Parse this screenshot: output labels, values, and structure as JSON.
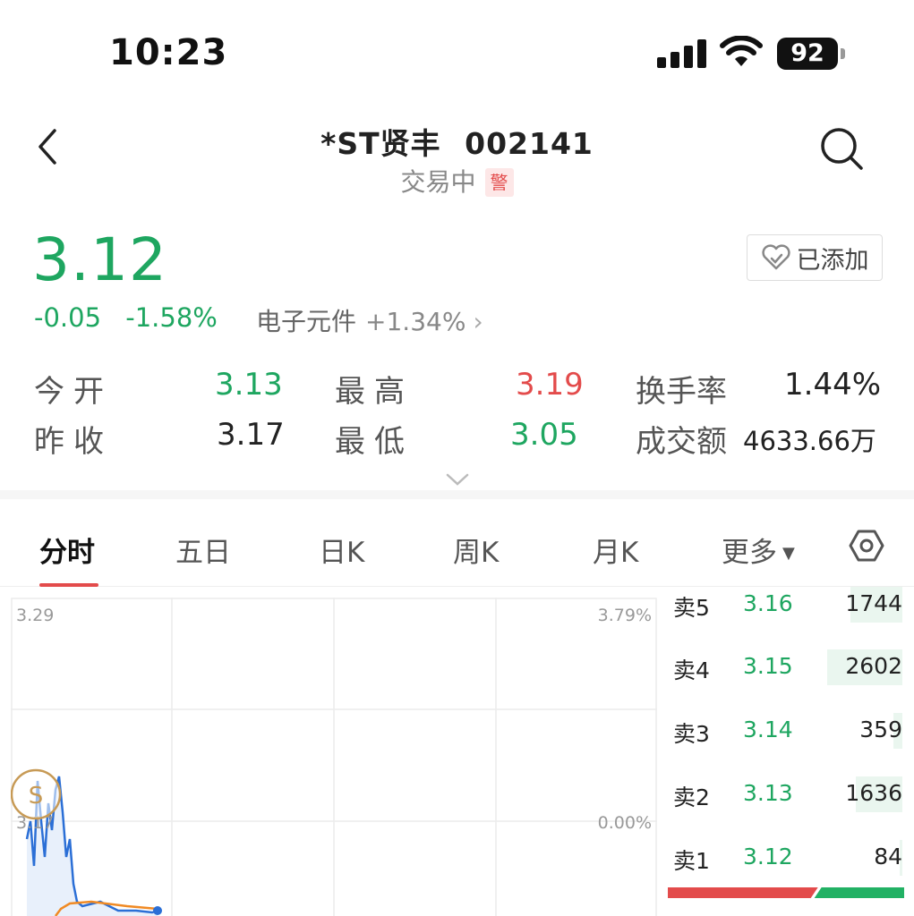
{
  "status_bar": {
    "time": "10:23",
    "battery": "92"
  },
  "header": {
    "stock_name": "*ST贤丰",
    "stock_code": "002141",
    "trading_status": "交易中",
    "warning_badge": "警"
  },
  "quote": {
    "price": "3.12",
    "change": "-0.05",
    "change_pct": "-1.58%",
    "sector_name": "电子元件",
    "sector_pct": "+1.34%",
    "watchlist_label": "已添加"
  },
  "stats": [
    {
      "label": "今开",
      "value": "3.13",
      "color": "green"
    },
    {
      "label": "最高",
      "value": "3.19",
      "color": "red"
    },
    {
      "label": "换手率",
      "value": "1.44%",
      "color": "dark"
    },
    {
      "label": "昨收",
      "value": "3.17",
      "color": "dark"
    },
    {
      "label": "最低",
      "value": "3.05",
      "color": "green"
    },
    {
      "label": "成交额",
      "value": "4633.66万",
      "color": "dark"
    }
  ],
  "tabs": [
    "分时",
    "五日",
    "日K",
    "周K",
    "月K",
    "更多"
  ],
  "active_tab": "分时",
  "chart": {
    "price_top": "3.29",
    "pct_top": "3.79%",
    "price_mid": "3.17",
    "pct_mid": "0.00%",
    "marker": "S",
    "colors": {
      "price_line": "#2b6fd6",
      "avg_line": "#f08a24",
      "grid": "#ececec"
    }
  },
  "order_book": {
    "asks": [
      {
        "label": "卖5",
        "price": "3.16",
        "volume": "1744",
        "depth": 0.22
      },
      {
        "label": "卖4",
        "price": "3.15",
        "volume": "2602",
        "depth": 0.32
      },
      {
        "label": "卖3",
        "price": "3.14",
        "volume": "359",
        "depth": 0.04
      },
      {
        "label": "卖2",
        "price": "3.13",
        "volume": "1636",
        "depth": 0.2
      },
      {
        "label": "卖1",
        "price": "3.12",
        "volume": "84",
        "depth": 0.01
      }
    ],
    "buy_ratio": 0.62,
    "colors": {
      "buy": "#e34b4b",
      "sell": "#22b164"
    }
  }
}
